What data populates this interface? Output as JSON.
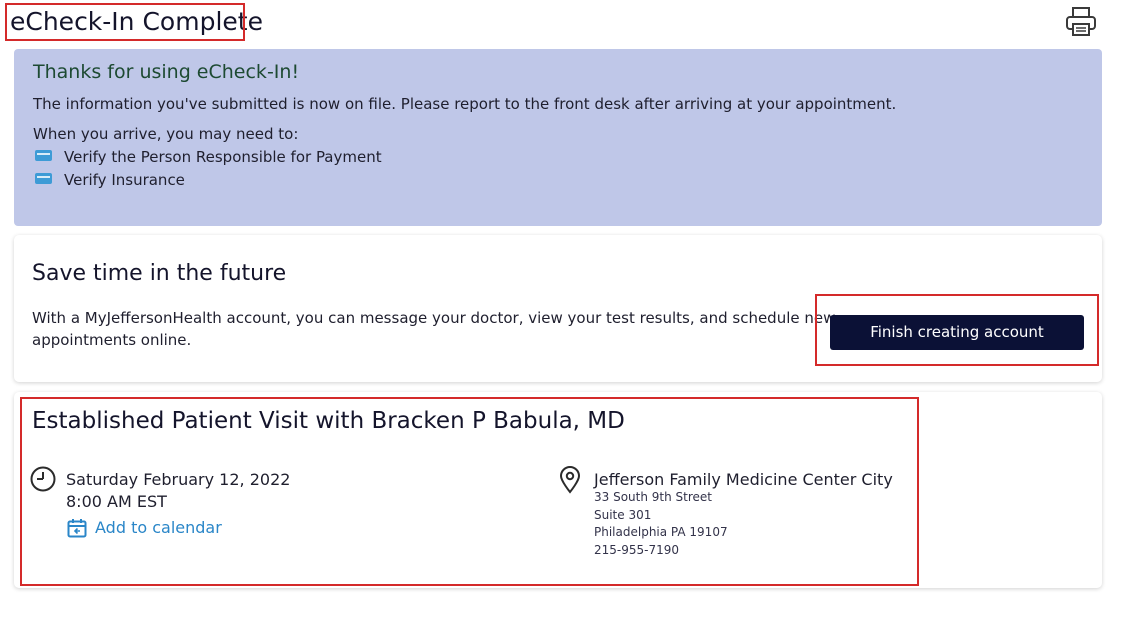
{
  "page": {
    "title": "eCheck-In Complete",
    "print_icon": "printer-icon"
  },
  "banner": {
    "heading": "Thanks for using eCheck-In!",
    "message": "The information you've submitted is now on file. Please report to the front desk after arriving at your appointment.",
    "intro": "When you arrive, you may need to:",
    "items": [
      {
        "icon": "credit-card-icon",
        "label": "Verify the Person Responsible for Payment"
      },
      {
        "icon": "credit-card-icon",
        "label": "Verify Insurance"
      }
    ]
  },
  "account_card": {
    "heading": "Save time in the future",
    "text_line1": "With a MyJeffersonHealth account, you can message your doctor, view your test results, and schedule new",
    "text_line2": "appointments online.",
    "button_label": "Finish creating account"
  },
  "visit_card": {
    "title": "Established Patient Visit with Bracken P Babula, MD",
    "date": "Saturday February 12, 2022",
    "time": "8:00 AM EST",
    "add_to_calendar": "Add to calendar",
    "location_name": "Jefferson Family Medicine Center City",
    "address_line1": "33 South 9th Street",
    "address_line2": "Suite 301",
    "address_line3": "Philadelphia PA 19107",
    "phone": "215-955-7190"
  },
  "colors": {
    "banner_bg": "#bfc7e8",
    "banner_heading": "#1d4a32",
    "button_bg": "#0b1136",
    "link": "#2a86c8",
    "highlight_box": "#d42a2a"
  }
}
